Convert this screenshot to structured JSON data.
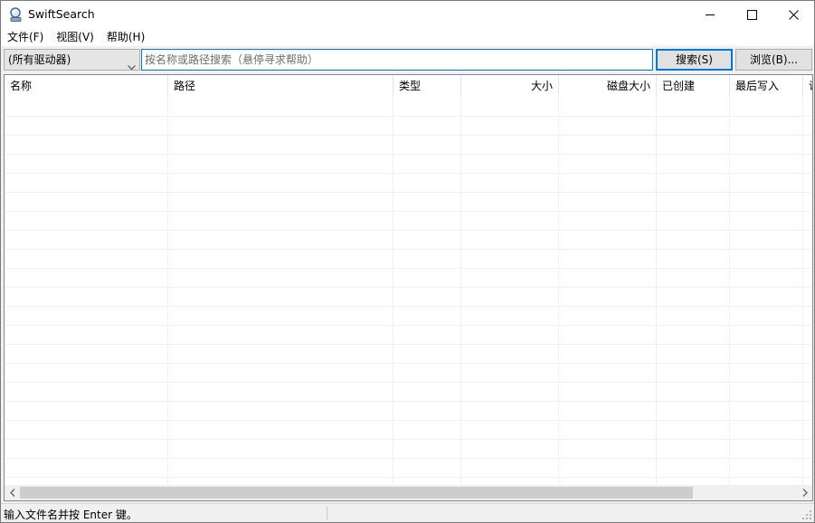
{
  "window": {
    "title": "SwiftSearch",
    "controls": {
      "minimize": "minimize-icon",
      "maximize": "maximize-icon",
      "close": "close-icon"
    }
  },
  "menu": {
    "items": [
      {
        "label": "文件(F)"
      },
      {
        "label": "视图(V)"
      },
      {
        "label": "帮助(H)"
      }
    ]
  },
  "toolbar": {
    "drive": {
      "value": "(所有驱动器)"
    },
    "search": {
      "placeholder": "按名称或路径搜索（悬停寻求帮助）",
      "value": ""
    },
    "search_button": "搜索(S)",
    "browse_button": "浏览(B)..."
  },
  "list": {
    "columns": [
      {
        "label": "名称",
        "align": "left"
      },
      {
        "label": "路径",
        "align": "left"
      },
      {
        "label": "类型",
        "align": "left"
      },
      {
        "label": "大小",
        "align": "right"
      },
      {
        "label": "磁盘大小",
        "align": "right"
      },
      {
        "label": "已创建",
        "align": "left"
      },
      {
        "label": "最后写入",
        "align": "left"
      },
      {
        "label": "访",
        "align": "left"
      }
    ],
    "rows": []
  },
  "status": {
    "text": "输入文件名并按 Enter 键。"
  },
  "colors": {
    "accent": "#0078d7",
    "window_bg": "#f0f0f0",
    "scroll_thumb": "#cdcdcd"
  }
}
